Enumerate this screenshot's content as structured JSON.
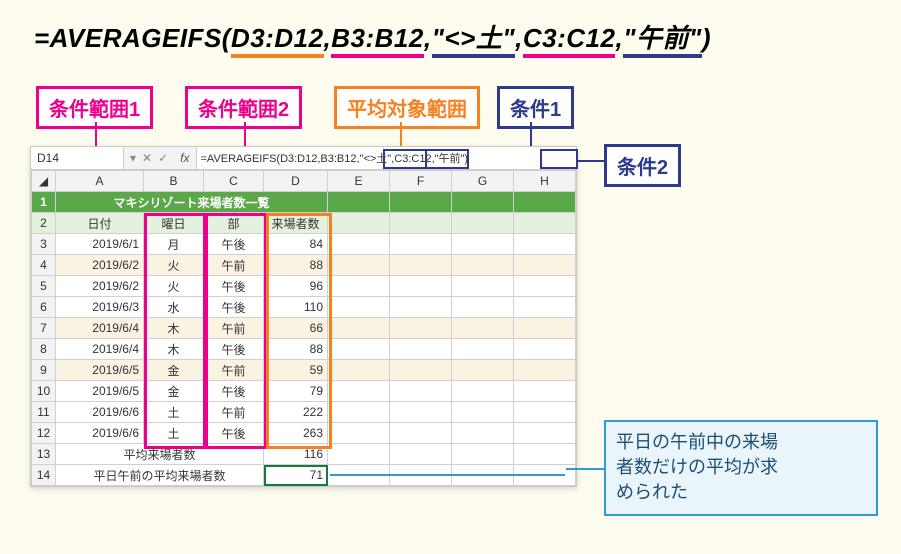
{
  "formula": {
    "prefix": "=AVERAGEIFS(",
    "arg1": "D3:D12",
    "sep": ",",
    "arg2": "B3:B12",
    "arg3": "\"<>土\"",
    "arg4": "C3:C12",
    "arg5": "\"午前\"",
    "suffix": ")"
  },
  "tags": {
    "range1": "条件範囲1",
    "range2": "条件範囲2",
    "avgrange": "平均対象範囲",
    "cond1": "条件1",
    "cond2": "条件2"
  },
  "excel": {
    "namebox": "D14",
    "fx_label": "fx",
    "formula_bar": "=AVERAGEIFS(D3:D12,B3:B12,\"<>土\",C3:C12,\"午前\")",
    "col_headers": [
      "A",
      "B",
      "C",
      "D",
      "E",
      "F",
      "G",
      "H"
    ],
    "title": "マキシリゾート来場者数一覧",
    "headers": {
      "date": "日付",
      "dow": "曜日",
      "part": "部",
      "count": "来場者数"
    },
    "rows": [
      {
        "n": 3,
        "date": "2019/6/1",
        "dow": "月",
        "part": "午後",
        "count": 84,
        "shade": false
      },
      {
        "n": 4,
        "date": "2019/6/2",
        "dow": "火",
        "part": "午前",
        "count": 88,
        "shade": true
      },
      {
        "n": 5,
        "date": "2019/6/2",
        "dow": "火",
        "part": "午後",
        "count": 96,
        "shade": false
      },
      {
        "n": 6,
        "date": "2019/6/3",
        "dow": "水",
        "part": "午後",
        "count": 110,
        "shade": false
      },
      {
        "n": 7,
        "date": "2019/6/4",
        "dow": "木",
        "part": "午前",
        "count": 66,
        "shade": true
      },
      {
        "n": 8,
        "date": "2019/6/4",
        "dow": "木",
        "part": "午後",
        "count": 88,
        "shade": false
      },
      {
        "n": 9,
        "date": "2019/6/5",
        "dow": "金",
        "part": "午前",
        "count": 59,
        "shade": true
      },
      {
        "n": 10,
        "date": "2019/6/5",
        "dow": "金",
        "part": "午後",
        "count": 79,
        "shade": false
      },
      {
        "n": 11,
        "date": "2019/6/6",
        "dow": "土",
        "part": "午前",
        "count": 222,
        "shade": false
      },
      {
        "n": 12,
        "date": "2019/6/6",
        "dow": "土",
        "part": "午後",
        "count": 263,
        "shade": false
      }
    ],
    "summary1": {
      "label": "平均来場者数",
      "value": 116
    },
    "summary2": {
      "label": "平日午前の平均来場者数",
      "value": 71
    }
  },
  "callout": {
    "line1": "平日の午前中の来場",
    "line2": "者数だけの平均が求",
    "line3": "められた"
  }
}
